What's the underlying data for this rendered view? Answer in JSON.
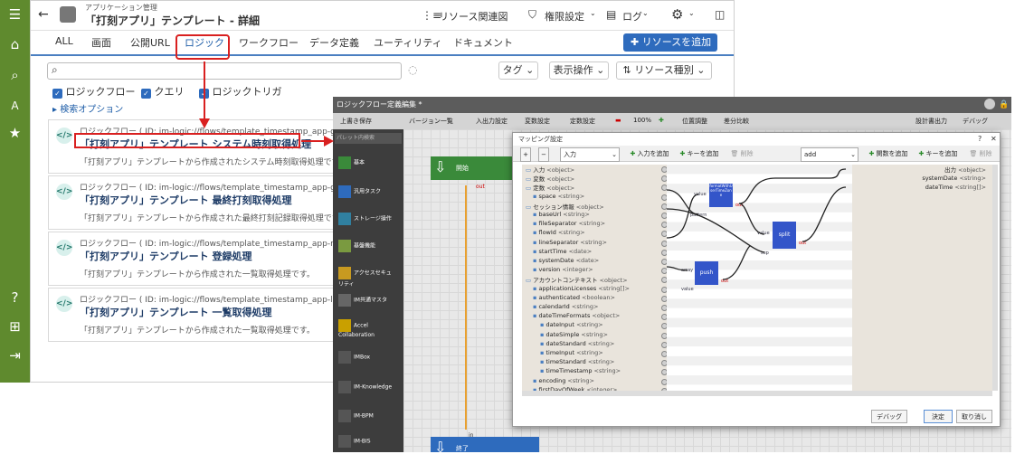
{
  "header": {
    "breadcrumb": "アプリケーション管理",
    "title": "「打刻アプリ」テンプレート - 詳細",
    "related_resources": "リソース関連図",
    "permission": "権限設定",
    "log": "ログ"
  },
  "tabs": [
    "ALL",
    "画面",
    "公開URL",
    "ロジック",
    "ワークフロー",
    "データ定義",
    "ユーティリティ",
    "ドキュメント"
  ],
  "add_resource": "リソースを追加",
  "search": {
    "placeholder": "",
    "tag": "タグ",
    "display_ops": "表示操作",
    "resource_type": "リソース種別"
  },
  "filters": [
    "ロジックフロー",
    "クエリ",
    "ロジックトリガ"
  ],
  "search_options": "検索オプション",
  "cards": [
    {
      "sub": "ロジックフロー ( ID: im-logic://flows/template_timestamp_app-getTime",
      "title": "「打刻アプリ」テンプレート システム時刻取得処理",
      "desc": "「打刻アプリ」テンプレートから作成されたシステム時刻取得処理です。"
    },
    {
      "sub": "ロジックフロー ( ID: im-logic://flows/template_timestamp_app-getNewest",
      "title": "「打刻アプリ」テンプレート 最終打刻取得処理",
      "desc": "「打刻アプリ」テンプレートから作成された最終打刻記録取得処理です。"
    },
    {
      "sub": "ロジックフロー ( ID: im-logic://flows/template_timestamp_app-register",
      "title": "「打刻アプリ」テンプレート 登録処理",
      "desc": "「打刻アプリ」テンプレートから作成された一覧取得処理です。"
    },
    {
      "sub": "ロジックフロー ( ID: im-logic://flows/template_timestamp_app-list",
      "title": "「打刻アプリ」テンプレート 一覧取得処理",
      "desc": "「打刻アプリ」テンプレートから作成された一覧取得処理です。"
    }
  ],
  "editor": {
    "title": "ロジックフロー定義編集 *",
    "toolbar": [
      "上書き保存",
      "バージョン一覧",
      "入出力設定",
      "変数設定",
      "定数設定",
      "100%",
      "位置調整",
      "差分比較",
      "設計書出力",
      "デバッグ"
    ],
    "palette_search": "パレット内検索",
    "palette": [
      "基本",
      "汎用タスク",
      "ストレージ操作",
      "基盤機能",
      "アクセスセキュリティ",
      "IM共通マスタ",
      "Accel Collaboration",
      "IMBox",
      "IM-Knowledge",
      "IM-BPM",
      "IM-BIS"
    ],
    "start": "開始",
    "end": "終了",
    "out": "out",
    "in": "in"
  },
  "dialog": {
    "title": "マッピング設定",
    "input_select": "入力",
    "add_input": "入力を追加",
    "add_key": "キーを追加",
    "delete": "削除",
    "func_select": "add",
    "add_func": "関数を追加",
    "tree": [
      {
        "l": "入力",
        "t": "<object>",
        "d": 0
      },
      {
        "l": "変数",
        "t": "<object>",
        "d": 0
      },
      {
        "l": "定数",
        "t": "<object>",
        "d": 0
      },
      {
        "l": "space",
        "t": "<string>",
        "d": 1
      },
      {
        "l": "セッション情報",
        "t": "<object>",
        "d": 0
      },
      {
        "l": "baseUrl",
        "t": "<string>",
        "d": 1
      },
      {
        "l": "fileSeparator",
        "t": "<string>",
        "d": 1
      },
      {
        "l": "flowId",
        "t": "<string>",
        "d": 1
      },
      {
        "l": "lineSeparator",
        "t": "<string>",
        "d": 1
      },
      {
        "l": "startTime",
        "t": "<date>",
        "d": 1
      },
      {
        "l": "systemDate",
        "t": "<date>",
        "d": 1
      },
      {
        "l": "version",
        "t": "<integer>",
        "d": 1
      },
      {
        "l": "アカウントコンテキスト",
        "t": "<object>",
        "d": 0
      },
      {
        "l": "applicationLicenses",
        "t": "<string[]>",
        "d": 1
      },
      {
        "l": "authenticated",
        "t": "<boolean>",
        "d": 1
      },
      {
        "l": "calendarId",
        "t": "<string>",
        "d": 1
      },
      {
        "l": "dateTimeFormats",
        "t": "<object>",
        "d": 1
      },
      {
        "l": "dateInput",
        "t": "<string>",
        "d": 2
      },
      {
        "l": "dateSimple",
        "t": "<string>",
        "d": 2
      },
      {
        "l": "dateStandard",
        "t": "<string>",
        "d": 2
      },
      {
        "l": "timeInput",
        "t": "<string>",
        "d": 2
      },
      {
        "l": "timeStandard",
        "t": "<string>",
        "d": 2
      },
      {
        "l": "timeTimestamp",
        "t": "<string>",
        "d": 2
      },
      {
        "l": "encoding",
        "t": "<string>",
        "d": 1
      },
      {
        "l": "firstDayOfWeek",
        "t": "<integer>",
        "d": 1
      }
    ],
    "outputs": [
      {
        "l": "出力",
        "t": "<object>"
      },
      {
        "l": "systemDate",
        "t": "<string>"
      },
      {
        "l": "dateTime",
        "t": "<string[]>"
      }
    ],
    "nodes": {
      "format": "formatWithUserTimeZone",
      "split": "split",
      "push": "push",
      "value": "value",
      "pattern": "pattern",
      "sep": "sep",
      "array": "array",
      "out": "out"
    },
    "debug": "デバッグ",
    "ok": "決定",
    "cancel": "取り消し"
  },
  "colors": {
    "accent": "#2e6bbd",
    "sidebar": "#5f8a2e",
    "highlight": "#d92020",
    "node": "#3355c9"
  }
}
